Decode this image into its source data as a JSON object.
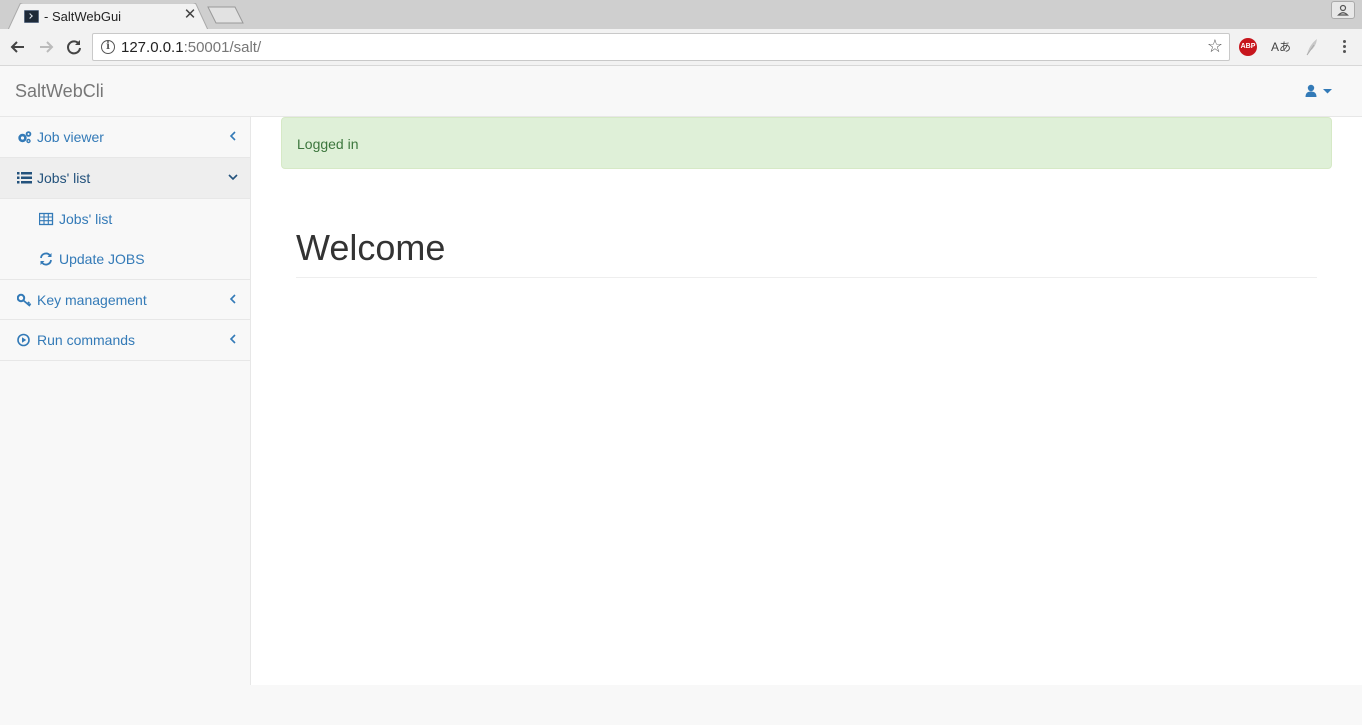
{
  "browser": {
    "tab_title": "- SaltWebGui",
    "url_host": "127.0.0.1",
    "url_rest": ":50001/salt/",
    "extensions": {
      "adblock_label": "ABP",
      "translate_label": "Aあ"
    }
  },
  "navbar": {
    "brand": "SaltWebCli",
    "user_icon": "user-icon"
  },
  "sidebar": {
    "items": [
      {
        "label": "Job viewer",
        "icon": "cogs-icon",
        "expanded": false
      },
      {
        "label": "Jobs' list",
        "icon": "list-icon",
        "expanded": true,
        "children": [
          {
            "label": "Jobs' list",
            "icon": "table-icon"
          },
          {
            "label": "Update JOBS",
            "icon": "refresh-icon"
          }
        ]
      },
      {
        "label": "Key management",
        "icon": "key-icon",
        "expanded": false
      },
      {
        "label": "Run commands",
        "icon": "play-circle-icon",
        "expanded": false
      }
    ]
  },
  "main": {
    "alert": "Logged in",
    "heading": "Welcome"
  },
  "colors": {
    "link": "#337ab7",
    "alert_bg": "#dff0d8",
    "alert_text": "#3c763d"
  }
}
